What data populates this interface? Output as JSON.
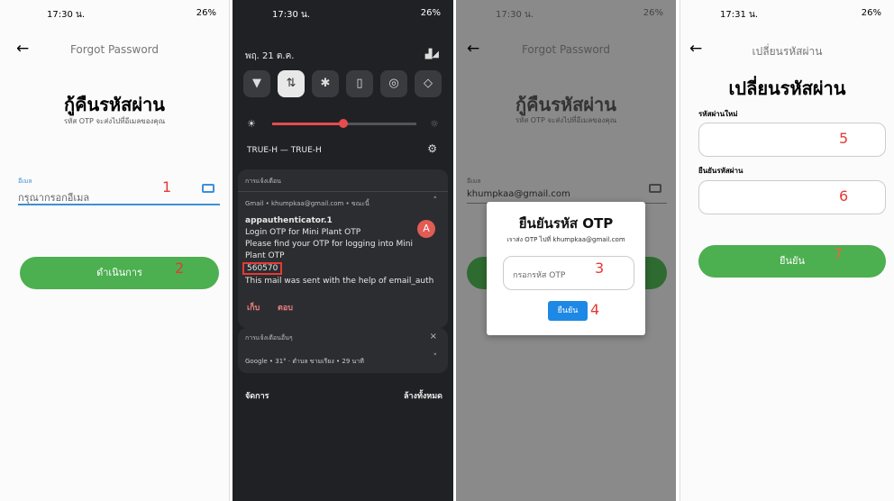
{
  "panel1": {
    "status_time": "17:30 น.",
    "status_right": "26%",
    "app_title": "Forgot Password",
    "heading": "กู้คืนรหัสผ่าน",
    "subheading": "รหัส OTP จะส่งไปที่อีเมลของคุณ",
    "email_label": "อีเมล",
    "email_placeholder": "กรุณากรอกอีเมล",
    "marker_email": "1",
    "button_label": "ดำเนินการ",
    "marker_button": "2"
  },
  "panel2": {
    "status_time": "17:30 น.",
    "status_right": "26%",
    "date": "พฤ. 21 ต.ค.",
    "network": "TRUE-H — TRUE-H",
    "notifications_header": "การแจ้งเตือน",
    "gmail_source": "Gmail • khumpkaa@gmail.com • ขณะนี้",
    "sender": "appauthenticator.1",
    "subject": "Login OTP for Mini Plant OTP",
    "body1": "Please find your OTP for logging into Mini",
    "body2": "Plant OTP",
    "otp": "560570",
    "body3": "This mail was sent with the help of email_auth",
    "avatar": "A",
    "action_archive": "เก็บ",
    "action_reply": "ตอบ",
    "other_header": "การแจ้งเตือนอื่นๆ",
    "weather": "Google • 31° · ตำบล ขามเรียง • 29 นาที",
    "manage": "จัดการ",
    "clear_all": "ล้างทั้งหมด"
  },
  "panel3": {
    "status_time": "17:30 น.",
    "status_right": "26%",
    "app_title": "Forgot Password",
    "heading": "กู้คืนรหัสผ่าน",
    "subheading": "รหัส OTP จะส่งไปที่อีเมลของคุณ",
    "email_label": "อีเมล",
    "email_value": "khumpkaa@gmail.com",
    "dialog_title": "ยืนยันรหัส OTP",
    "dialog_sub": "เราส่ง OTP ไปที่ khumpkaa@gmail.com",
    "otp_placeholder": "กรอกรหัส OTP",
    "marker_otp": "3",
    "confirm_label": "ยืนยัน",
    "marker_confirm": "4"
  },
  "panel4": {
    "status_time": "17:31 น.",
    "status_right": "26%",
    "app_title": "เปลี่ยนรหัสผ่าน",
    "heading": "เปลี่ยนรหัสผ่าน",
    "new_label": "รหัสผ่านใหม่",
    "marker_new": "5",
    "confirm_label": "ยืนยันรหัสผ่าน",
    "marker_confirm_field": "6",
    "button_label": "ยืนยัน",
    "marker_button": "7"
  },
  "colors": {
    "green": "#4caf50",
    "red_marker": "#e53935",
    "blue": "#1e88e5",
    "dark": "#202124"
  }
}
